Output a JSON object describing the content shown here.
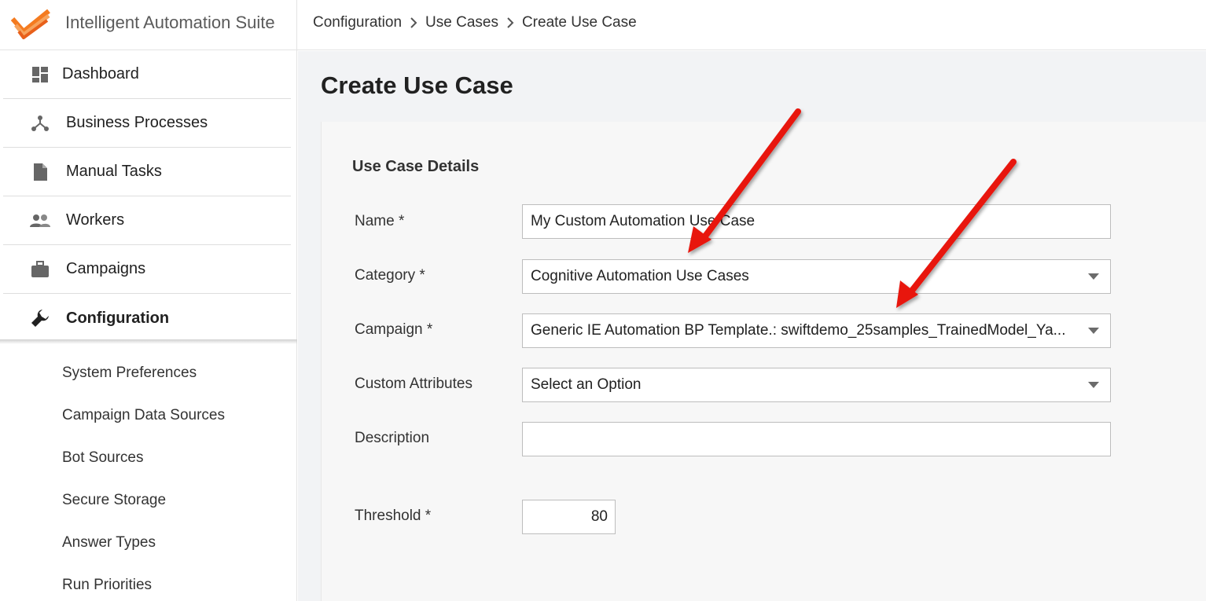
{
  "header": {
    "app_title": "Intelligent Automation Suite",
    "brand_color": "#f47b20",
    "breadcrumb": [
      "Configuration",
      "Use Cases",
      "Create Use Case"
    ],
    "separator_icon": "chevron-right-icon"
  },
  "sidebar": {
    "items": [
      {
        "label": "Dashboard",
        "icon": "dashboard-icon"
      },
      {
        "label": "Business Processes",
        "icon": "process-icon"
      },
      {
        "label": "Manual Tasks",
        "icon": "document-icon"
      },
      {
        "label": "Workers",
        "icon": "people-icon"
      },
      {
        "label": "Campaigns",
        "icon": "briefcase-icon"
      },
      {
        "label": "Configuration",
        "icon": "wrench-icon",
        "active": true
      }
    ],
    "sub_items": [
      "System Preferences",
      "Campaign Data Sources",
      "Bot Sources",
      "Secure Storage",
      "Answer Types",
      "Run Priorities"
    ]
  },
  "main": {
    "page_title": "Create Use Case",
    "section_title": "Use Case Details",
    "form": {
      "name": {
        "label": "Name *",
        "value": "My Custom Automation Use Case"
      },
      "category": {
        "label": "Category *",
        "value": "Cognitive Automation Use Cases"
      },
      "campaign": {
        "label": "Campaign *",
        "value": "Generic IE Automation BP Template.: swiftdemo_25samples_TrainedModel_Ya..."
      },
      "custom_attributes": {
        "label": "Custom Attributes",
        "value": "Select an Option"
      },
      "description": {
        "label": "Description",
        "value": ""
      },
      "threshold": {
        "label": "Threshold *",
        "value": "80"
      }
    }
  },
  "annotation": {
    "arrow_color": "#e8140c"
  }
}
